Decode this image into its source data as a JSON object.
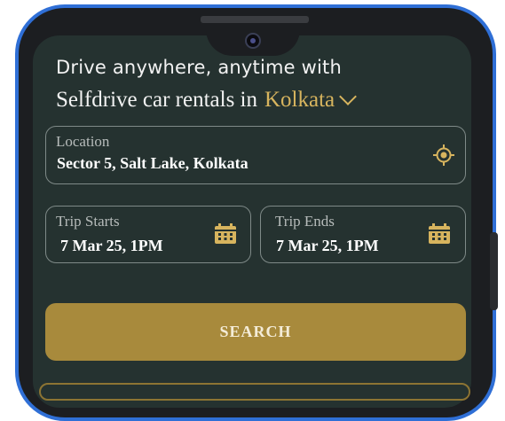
{
  "header": {
    "line1": "Drive anywhere, anytime with",
    "line2": "Selfdrive car rentals in",
    "city": "Kolkata"
  },
  "location": {
    "label": "Location",
    "value": "Sector 5, Salt Lake, Kolkata",
    "icon": "locate-icon"
  },
  "trip_start": {
    "label": "Trip Starts",
    "value": "7 Mar 25, 1PM",
    "icon": "calendar-icon"
  },
  "trip_end": {
    "label": "Trip Ends",
    "value": "7 Mar 25, 1PM",
    "icon": "calendar-icon"
  },
  "search": {
    "label": "SEARCH"
  },
  "colors": {
    "screen_bg": "#253230",
    "accent_gold": "#d7b45e",
    "button_gold": "#a88a3c",
    "frame_blue": "#2f6fd6"
  }
}
